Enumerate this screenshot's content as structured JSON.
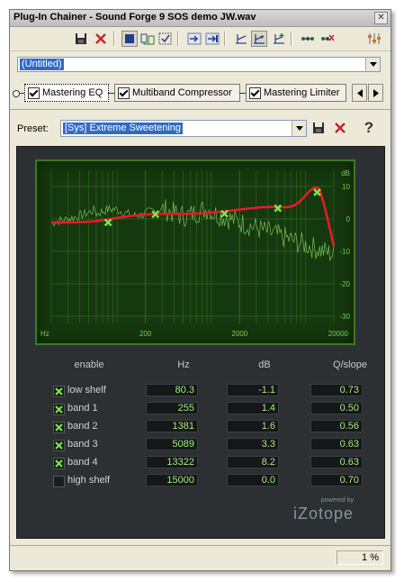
{
  "window": {
    "title": "Plug-In Chainer - Sound Forge 9 SOS demo JW.wav",
    "close_glyph": "✕"
  },
  "toolbar": {
    "icons": [
      "save-icon",
      "remove-icon",
      "bypass-icon",
      "insert-icon",
      "configure-icon",
      "move-right-icon",
      "move-left-icon",
      "filter-icon",
      "active-filter-icon",
      "add-filter-icon",
      "chain-icon",
      "chain-remove-icon",
      "mixer-icon"
    ]
  },
  "chain_preset": {
    "value": "(Untitled)"
  },
  "plugins": [
    {
      "label": "Mastering EQ",
      "checked": true,
      "active": true
    },
    {
      "label": "Multiband Compressor",
      "checked": true,
      "active": false
    },
    {
      "label": "Mastering Limiter",
      "checked": true,
      "active": false
    }
  ],
  "preset": {
    "label": "Preset:",
    "value": "[Sys] Extreme Sweetening",
    "help": "?"
  },
  "graph": {
    "y_title": "dB",
    "y_ticks": [
      "10",
      "0",
      "-10",
      "-20",
      "-30"
    ],
    "x_ticks": [
      "Hz",
      "200",
      "2000",
      "20000"
    ],
    "curve_color": "#e8192b",
    "spectrum_color": "#8ee06a",
    "node_color": "#7bea4c"
  },
  "table": {
    "headers": {
      "enable": "enable",
      "hz": "Hz",
      "db": "dB",
      "q": "Q/slope"
    },
    "rows": [
      {
        "label": "low shelf",
        "enabled": true,
        "hz": "80.3",
        "db": "-1.1",
        "q": "0.73"
      },
      {
        "label": "band 1",
        "enabled": true,
        "hz": "255",
        "db": "1.4",
        "q": "0.50"
      },
      {
        "label": "band 2",
        "enabled": true,
        "hz": "1381",
        "db": "1.6",
        "q": "0.56"
      },
      {
        "label": "band 3",
        "enabled": true,
        "hz": "5089",
        "db": "3.3",
        "q": "0.63"
      },
      {
        "label": "band 4",
        "enabled": true,
        "hz": "13322",
        "db": "8.2",
        "q": "0.63"
      },
      {
        "label": "high shelf",
        "enabled": false,
        "hz": "15000",
        "db": "0.0",
        "q": "0.70"
      }
    ]
  },
  "logo": {
    "powered": "powered by",
    "name": "iZotope"
  },
  "status": {
    "zoom": "1 %"
  }
}
